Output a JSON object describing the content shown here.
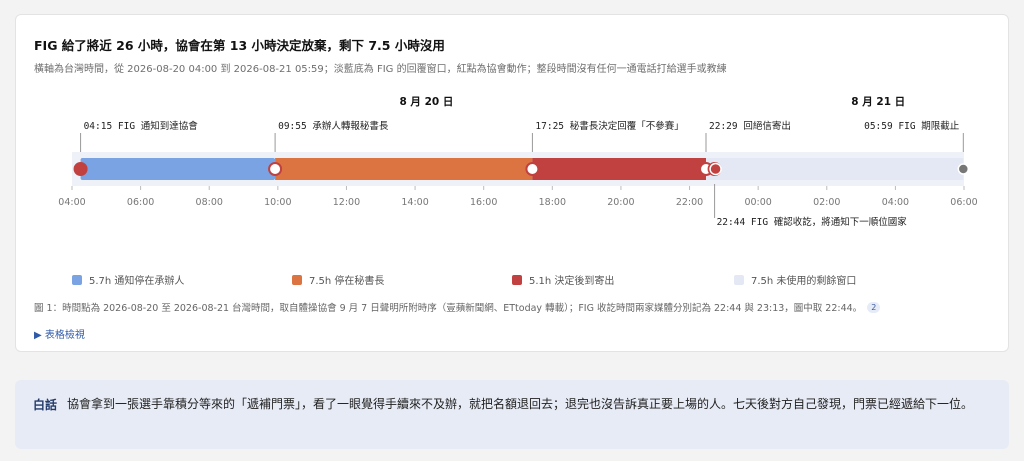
{
  "title": "FIG 給了將近 26 小時，協會在第 13 小時決定放棄，剩下 7.5 小時沒用",
  "subtitle": "橫軸為台灣時間，從 2026-08-20 04:00 到 2026-08-21 05:59；淡藍底為 FIG 的回覆窗口，紅點為協會動作；整段時間沒有任何一通電話打給選手或教練",
  "colors": {
    "notify": "#7aa3e3",
    "secretary": "#dc7442",
    "decided": "#c0413f",
    "unused": "#e4e8f4",
    "band": "#eef1f8",
    "end_marker": "#777777"
  },
  "chart_data": {
    "type": "timeline",
    "x_range_hours": [
      0,
      26
    ],
    "x_origin_label": "2026-08-20 04:00",
    "day_labels": [
      {
        "label": "8 月 20 日",
        "hour": 10.33
      },
      {
        "label": "8 月 21 日",
        "hour": 23.5
      }
    ],
    "ticks": [
      {
        "hour": 0,
        "label": "04:00"
      },
      {
        "hour": 2,
        "label": "06:00"
      },
      {
        "hour": 4,
        "label": "08:00"
      },
      {
        "hour": 6,
        "label": "10:00"
      },
      {
        "hour": 8,
        "label": "12:00"
      },
      {
        "hour": 10,
        "label": "14:00"
      },
      {
        "hour": 12,
        "label": "16:00"
      },
      {
        "hour": 14,
        "label": "18:00"
      },
      {
        "hour": 16,
        "label": "20:00"
      },
      {
        "hour": 18,
        "label": "22:00"
      },
      {
        "hour": 20,
        "label": "00:00"
      },
      {
        "hour": 22,
        "label": "02:00"
      },
      {
        "hour": 24,
        "label": "04:00"
      },
      {
        "hour": 26,
        "label": "06:00"
      }
    ],
    "segments": [
      {
        "start": 0.25,
        "end": 5.92,
        "color_key": "notify"
      },
      {
        "start": 5.92,
        "end": 13.42,
        "color_key": "secretary"
      },
      {
        "start": 13.42,
        "end": 18.48,
        "color_key": "decided"
      },
      {
        "start": 18.48,
        "end": 25.98,
        "color_key": "unused"
      }
    ],
    "events": [
      {
        "hour": 0.25,
        "label": "04:15 FIG 通知到達協會",
        "side": "above",
        "color_key": "decided"
      },
      {
        "hour": 5.92,
        "label": "09:55 承辦人轉報秘書長",
        "side": "above",
        "color_key": "decided"
      },
      {
        "hour": 13.42,
        "label": "17:25 秘書長決定回覆「不參賽」",
        "side": "above",
        "color_key": "decided"
      },
      {
        "hour": 18.48,
        "label": "22:29 回絕信寄出",
        "side": "above",
        "color_key": "decided"
      },
      {
        "hour": 18.73,
        "label": "22:44 FIG 確認收訖，將通知下一順位國家",
        "side": "below",
        "color_key": "decided"
      },
      {
        "hour": 25.98,
        "label": "05:59 FIG 期限截止",
        "side": "above",
        "color_key": "end_marker"
      }
    ]
  },
  "legend": [
    {
      "label": "5.7h 通知停在承辦人",
      "color_key": "notify"
    },
    {
      "label": "7.5h 停在秘書長",
      "color_key": "secretary"
    },
    {
      "label": "5.1h 決定後到寄出",
      "color_key": "decided"
    },
    {
      "label": "7.5h 未使用的剩餘窗口",
      "color_key": "unused"
    }
  ],
  "note": "圖 1：時間點為 2026-08-20 至 2026-08-21 台灣時間，取自體操協會 9 月 7 日聲明所附時序（壹蘋新聞網、ETtoday 轉載）；FIG 收訖時間兩家媒體分別記為 22:44 與 23:13，圖中取 22:44。",
  "note_badge": "2",
  "table_toggle": "▶ 表格檢視",
  "plain": {
    "label": "白話",
    "text": "協會拿到一張選手靠積分等來的「遞補門票」，看了一眼覺得手續來不及辦，就把名額退回去；退完也沒告訴真正要上場的人。七天後對方自己發現，門票已經遞給下一位。"
  }
}
